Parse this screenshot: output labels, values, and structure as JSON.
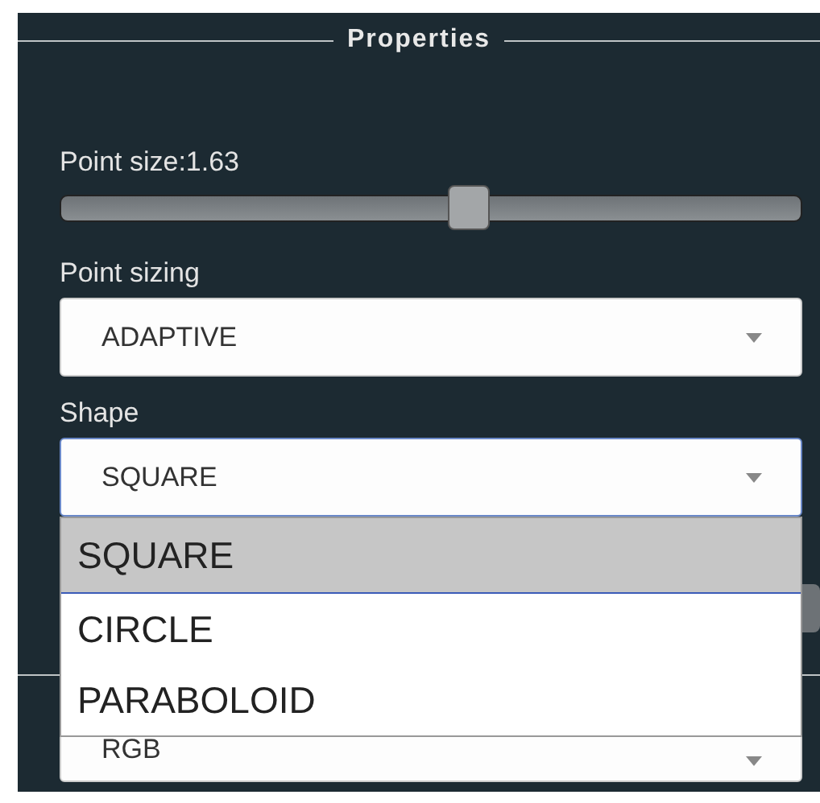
{
  "panel": {
    "title": "Properties"
  },
  "point_size": {
    "label": "Point size:1.63",
    "level": 0.55
  },
  "point_sizing": {
    "label": "Point sizing",
    "value": "ADAPTIVE"
  },
  "shape": {
    "label": "Shape",
    "value": "SQUARE",
    "expanded": true,
    "options": [
      {
        "label": "SQUARE",
        "selected": true
      },
      {
        "label": "CIRCLE",
        "selected": false
      },
      {
        "label": "PARABOLOID",
        "selected": false
      }
    ]
  },
  "color_select": {
    "value": "RGB"
  }
}
